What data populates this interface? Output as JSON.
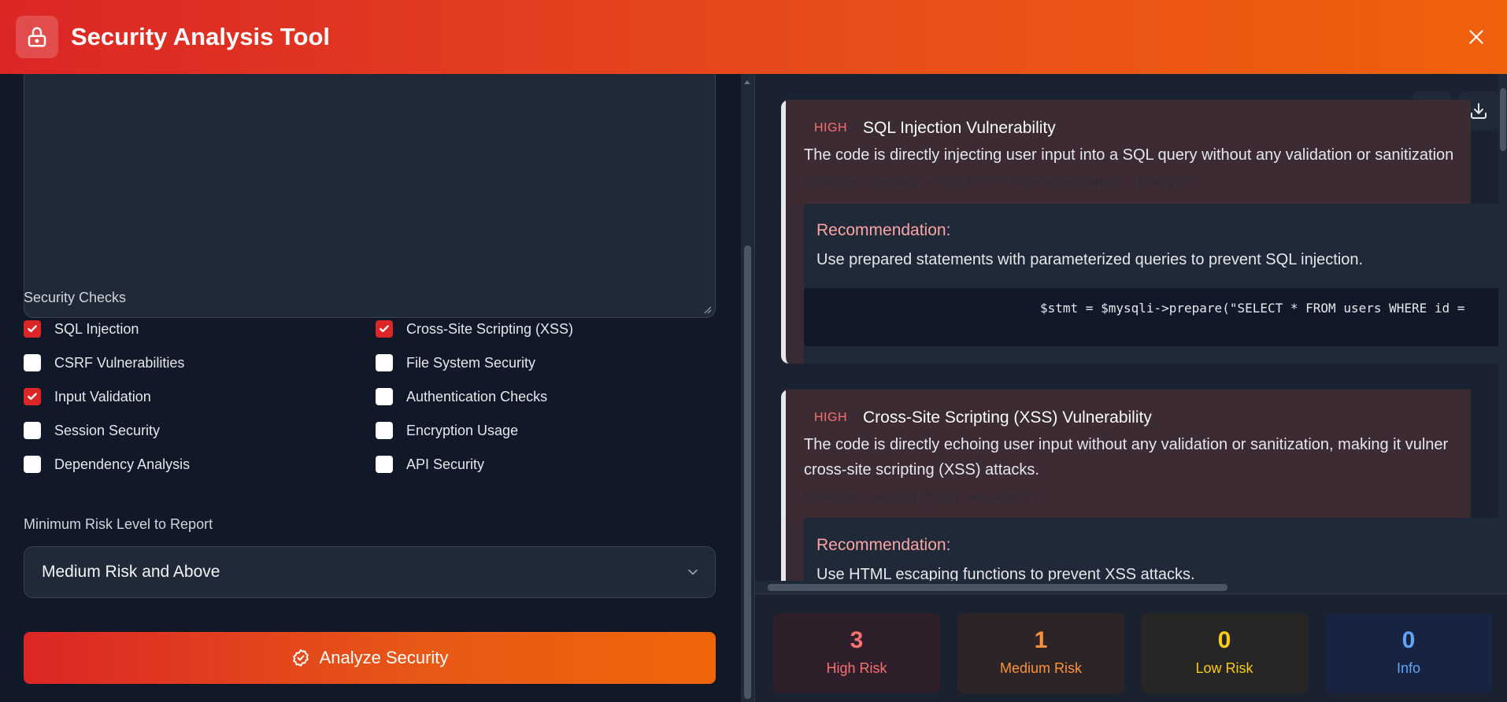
{
  "header": {
    "title": "Security Analysis Tool"
  },
  "left": {
    "checks_label": "Security Checks",
    "checks": [
      {
        "label": "SQL Injection",
        "checked": true
      },
      {
        "label": "Cross-Site Scripting (XSS)",
        "checked": true
      },
      {
        "label": "CSRF Vulnerabilities",
        "checked": false
      },
      {
        "label": "File System Security",
        "checked": false
      },
      {
        "label": "Input Validation",
        "checked": true
      },
      {
        "label": "Authentication Checks",
        "checked": false
      },
      {
        "label": "Session Security",
        "checked": false
      },
      {
        "label": "Encryption Usage",
        "checked": false
      },
      {
        "label": "Dependency Analysis",
        "checked": false
      },
      {
        "label": "API Security",
        "checked": false
      }
    ],
    "risk_label": "Minimum Risk Level to Report",
    "risk_value": "Medium Risk and Above",
    "analyze_label": "Analyze Security"
  },
  "results": [
    {
      "severity": "HIGH",
      "title": "SQL Injection Vulnerability",
      "description": "The code is directly injecting user input into a SQL query without any validation or sanitization",
      "location": "Location: $query = \"SELECT * FROM users WHERE id = $id\"",
      "rec_title": "Recommendation:",
      "rec_text": "Use prepared statements with parameterized queries to prevent SQL injection.",
      "code": "$stmt = $mysqli->prepare(\"SELECT * FROM users WHERE id ="
    },
    {
      "severity": "HIGH",
      "title": "Cross-Site Scripting (XSS) Vulnerability",
      "description_line1": "The code is directly echoing user input without any validation or sanitization, making it vulner",
      "description_line2": "cross-site scripting (XSS) attacks.",
      "location": "Location: echo $_POST['message'];",
      "rec_title": "Recommendation:",
      "rec_text": "Use HTML escaping functions to prevent XSS attacks."
    }
  ],
  "stats": [
    {
      "value": "3",
      "label": "High Risk",
      "color": "#f87171",
      "bg": "#2e1f2a"
    },
    {
      "value": "1",
      "label": "Medium Risk",
      "color": "#fb923c",
      "bg": "#2d2426"
    },
    {
      "value": "0",
      "label": "Low Risk",
      "color": "#facc15",
      "bg": "#272625"
    },
    {
      "value": "0",
      "label": "Info",
      "color": "#60a5fa",
      "bg": "#172340"
    }
  ],
  "icons": {
    "lock": "lock-icon",
    "close": "close-icon",
    "copy": "clipboard-icon",
    "download": "download-icon",
    "check": "check-circle-icon",
    "chevron": "chevron-down-icon"
  }
}
